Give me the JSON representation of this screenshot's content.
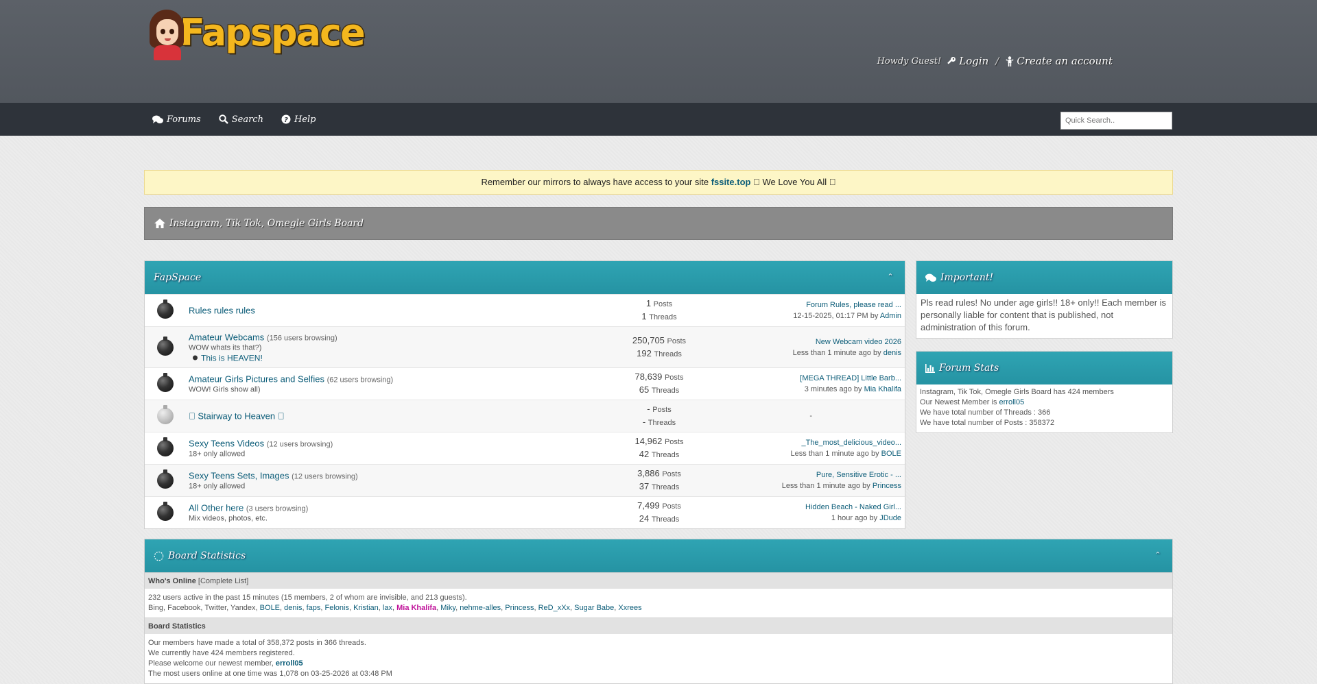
{
  "header": {
    "logo_text": "Fapspace",
    "greeting": "Howdy Guest!",
    "login": "Login",
    "separator": "/",
    "create_account": "Create an account"
  },
  "nav": {
    "forums": "Forums",
    "search": "Search",
    "help": "Help",
    "quick_search_placeholder": "Quick Search.."
  },
  "notice": {
    "prefix": "Remember our mirrors to always have access to your site",
    "link": "fssite.top",
    "suffix": "\u0000 We Love You All \u0000"
  },
  "breadcrumb": {
    "title": "Instagram, Tik Tok, Omegle Girls Board"
  },
  "forum": {
    "category": "FapSpace",
    "rows": [
      {
        "title": "Rules rules rules",
        "browsing": "",
        "desc": "",
        "subforum": "",
        "posts": "1",
        "threads": "1",
        "posts_label": "Posts",
        "threads_label": "Threads",
        "last_title": "Forum Rules, please read ...",
        "last_time": "12-15-2025, 01:17 PM by",
        "last_user": "Admin",
        "icon": "forum-icon"
      },
      {
        "title": "Amateur Webcams",
        "browsing": "(156 users browsing)",
        "desc": "WOW whats its that?)",
        "subforum": "This is HEAVEN!",
        "posts": "250,705",
        "threads": "192",
        "posts_label": "Posts",
        "threads_label": "Threads",
        "last_title": "New Webcam video 2026",
        "last_time": "Less than 1 minute ago by",
        "last_user": "denis",
        "icon": "forum-icon"
      },
      {
        "title": "Amateur Girls Pictures and Selfies",
        "browsing": "(62 users browsing)",
        "desc": "WOW! Girls show all)",
        "subforum": "",
        "posts": "78,639",
        "threads": "65",
        "posts_label": "Posts",
        "threads_label": "Threads",
        "last_title": "[MEGA THREAD] Little Barb...",
        "last_time": "3 minutes ago by",
        "last_user": "Mia Khalifa",
        "icon": "forum-icon"
      },
      {
        "title": "\u0000 Stairway to Heaven \u0000",
        "browsing": "",
        "desc": "",
        "subforum": "",
        "posts": "-",
        "threads": "-",
        "posts_label": "Posts",
        "threads_label": "Threads",
        "last_title": "",
        "last_time": "-",
        "last_user": "",
        "icon": "link-forum-icon"
      },
      {
        "title": "Sexy Teens Videos",
        "browsing": "(12 users browsing)",
        "desc": "18+ only allowed",
        "subforum": "",
        "posts": "14,962",
        "threads": "42",
        "posts_label": "Posts",
        "threads_label": "Threads",
        "last_title": "_The_most_delicious_video...",
        "last_time": "Less than 1 minute ago by",
        "last_user": "BOLE",
        "icon": "forum-icon"
      },
      {
        "title": "Sexy Teens Sets, Images",
        "browsing": "(12 users browsing)",
        "desc": "18+ only allowed",
        "subforum": "",
        "posts": "3,886",
        "threads": "37",
        "posts_label": "Posts",
        "threads_label": "Threads",
        "last_title": "Pure, Sensitive Erotic - ...",
        "last_time": "Less than 1 minute ago by",
        "last_user": "Princess",
        "icon": "forum-icon"
      },
      {
        "title": "All Other here",
        "browsing": "(3 users browsing)",
        "desc": "Mix videos, photos, etc.",
        "subforum": "",
        "posts": "7,499",
        "threads": "24",
        "posts_label": "Posts",
        "threads_label": "Threads",
        "last_title": "Hidden Beach - Naked Girl...",
        "last_time": "1 hour ago by",
        "last_user": "JDude",
        "icon": "forum-icon"
      }
    ]
  },
  "important": {
    "title": "Important!",
    "body": "Pls read rules! No under age girls!! 18+ only!! Each member is personally liable for content that is published, not administration of this forum."
  },
  "forum_stats": {
    "title": "Forum Stats",
    "line1": "Instagram, Tik Tok, Omegle Girls Board has 424 members",
    "line2_prefix": "Our Newest Member is",
    "line2_user": "erroll05",
    "line3": "We have total number of Threads : 366",
    "line4": "We have total number of Posts : 358372"
  },
  "board_stats": {
    "title": "Board Statistics",
    "whos_online_label": "Who's Online",
    "complete_list": "[Complete List]",
    "active_line": "232 users active in the past 15 minutes (15 members, 2 of whom are invisible, and 213 guests).",
    "bots": "Bing, Facebook, Twitter, Yandex,",
    "users": [
      {
        "name": "BOLE",
        "pink": false
      },
      {
        "name": "denis",
        "pink": false
      },
      {
        "name": "faps",
        "pink": false
      },
      {
        "name": "Felonis",
        "pink": false
      },
      {
        "name": "Kristian",
        "pink": false
      },
      {
        "name": "lax",
        "pink": false
      },
      {
        "name": "Mia Khalifa",
        "pink": true
      },
      {
        "name": "Miky",
        "pink": false
      },
      {
        "name": "nehme-alles",
        "pink": false
      },
      {
        "name": "Princess",
        "pink": false
      },
      {
        "name": "ReD_xXx",
        "pink": false
      },
      {
        "name": "Sugar Babe",
        "pink": false
      },
      {
        "name": "Xxrees",
        "pink": false
      }
    ],
    "stats_label": "Board Statistics",
    "stat1": "Our members have made a total of 358,372 posts in 366 threads.",
    "stat2": "We currently have 424 members registered.",
    "stat3_prefix": "Please welcome our newest member,",
    "stat3_user": "erroll05",
    "stat4": "The most users online at one time was 1,078 on 03-25-2026 at 03:48 PM"
  },
  "colors": {
    "accent_teal": "#2fa4b3",
    "header_gray": "#5c6168",
    "nav_dark": "#2e333a",
    "logo_yellow": "#f4b71e",
    "link": "#0b5c78",
    "highlight_user": "#c0129a"
  }
}
